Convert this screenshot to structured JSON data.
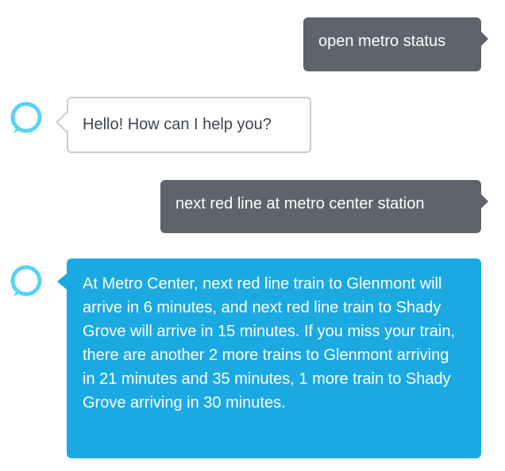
{
  "colors": {
    "user_bubble": "#5f636b",
    "assistant_bubble_outline": "#c9cdd1",
    "assistant_bubble_blue": "#1ba9e1",
    "avatar_ring": "#58d2f5"
  },
  "conversation": [
    {
      "role": "user",
      "text": "open metro status"
    },
    {
      "role": "assistant",
      "avatar_icon": "alexa-ring-icon",
      "text": "Hello! How can I help you?"
    },
    {
      "role": "user",
      "text": "next red line at metro center station"
    },
    {
      "role": "assistant",
      "avatar_icon": "alexa-ring-icon",
      "text": "At Metro Center, next red line train to Glenmont will arrive in 6 minutes, and next red line train to Shady Grove will arrive in 15 minutes. If you miss your train, there are another 2 more trains to Glenmont arriving in 21 minutes and 35 minutes, 1 more train to Shady Grove arriving in 30 minutes."
    }
  ]
}
